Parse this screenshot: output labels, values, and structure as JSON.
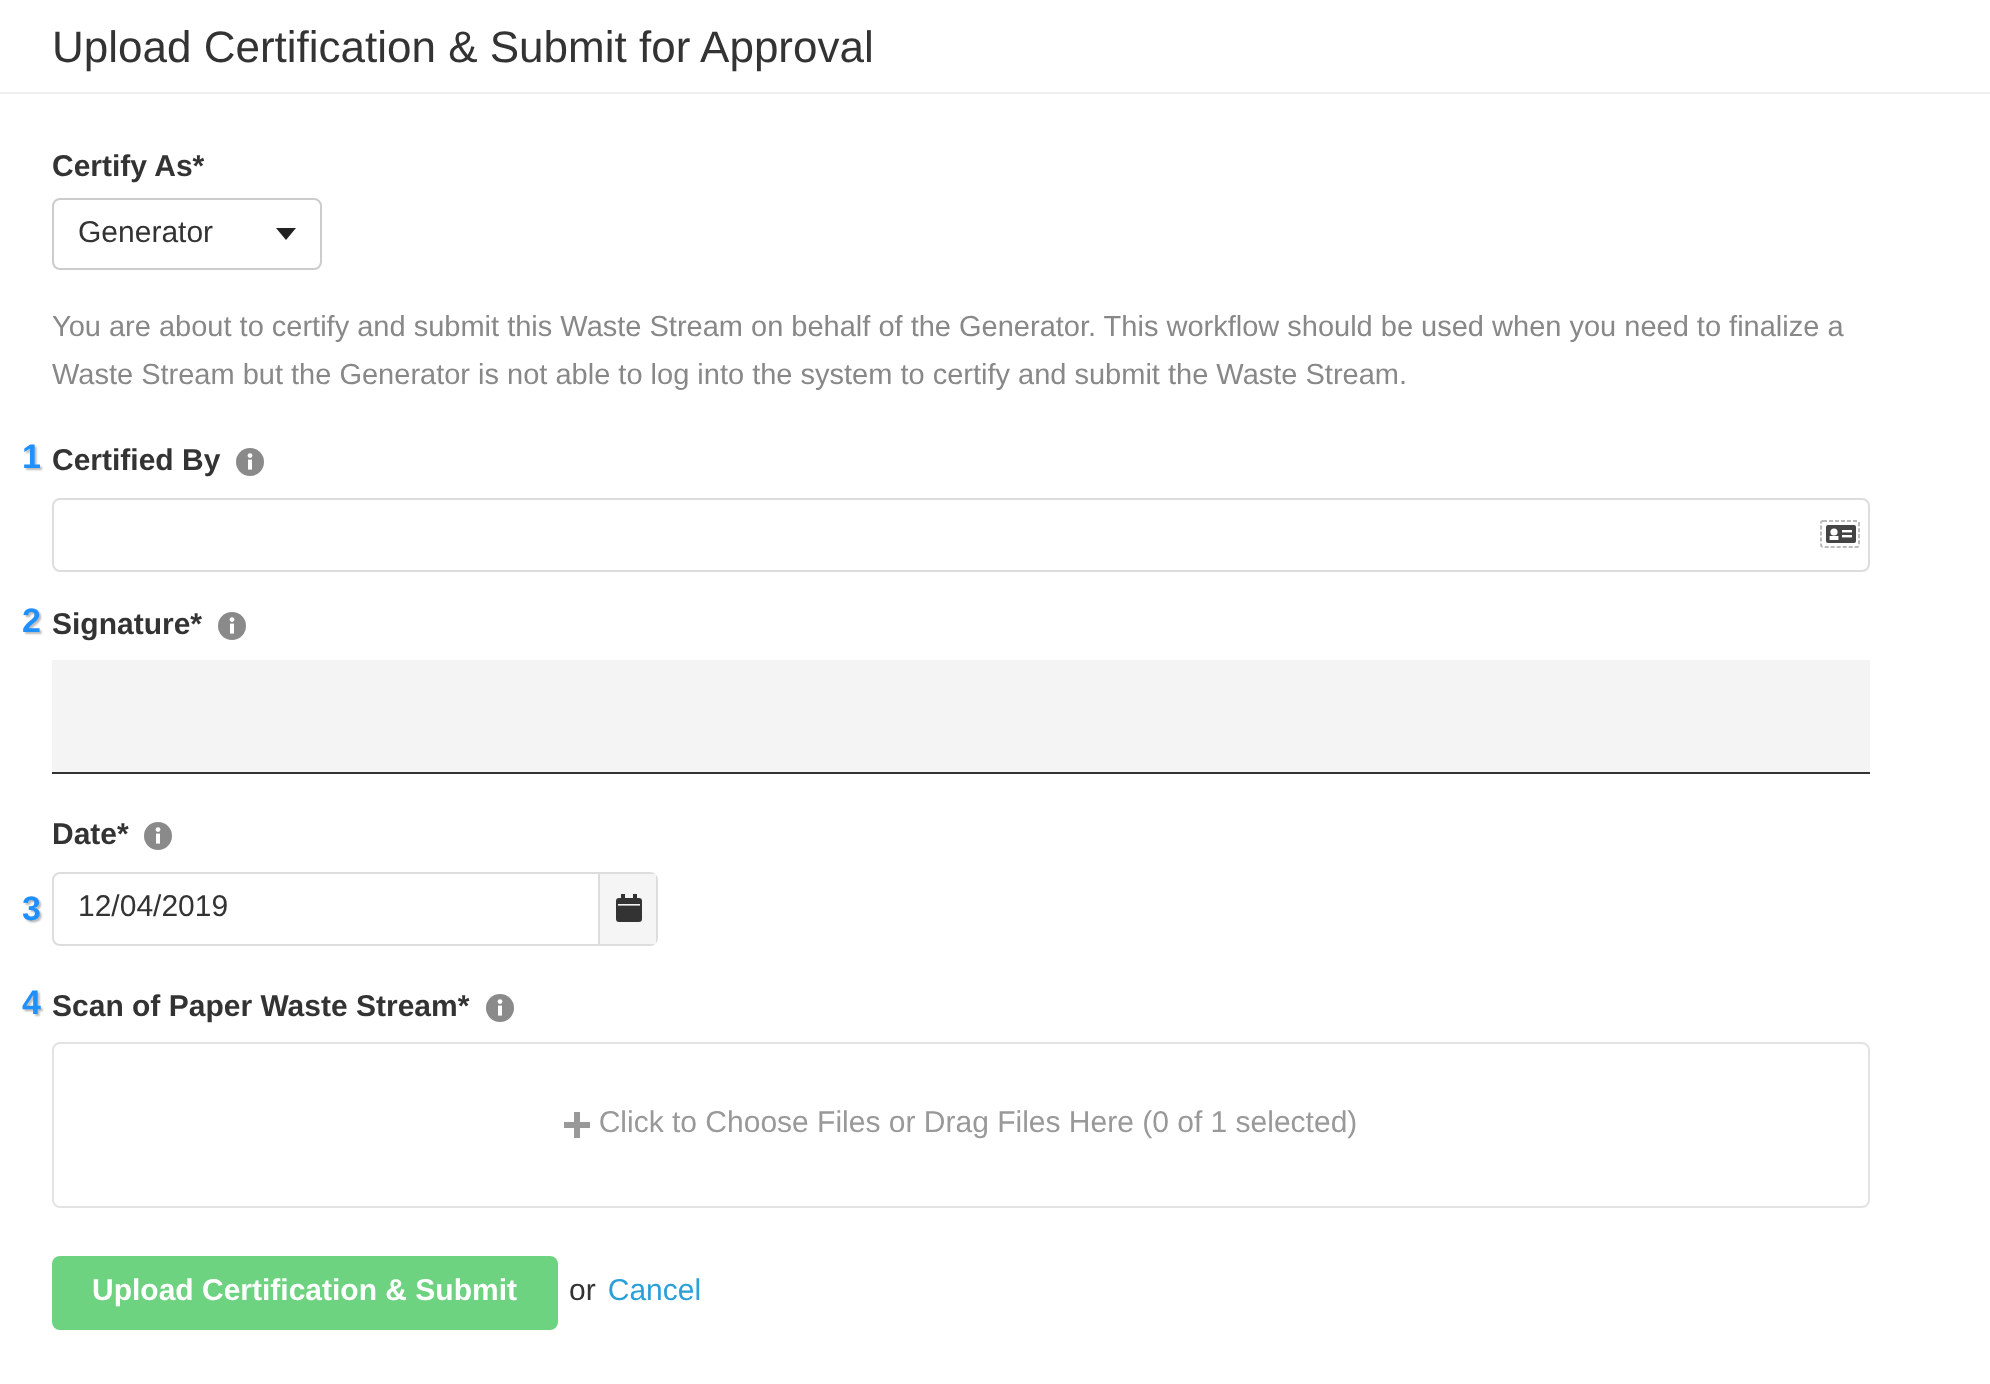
{
  "dialog": {
    "title": "Upload Certification & Submit for Approval"
  },
  "certify_as": {
    "label": "Certify As*",
    "value": "Generator"
  },
  "description": "You are about to certify and submit this Waste Stream on behalf of the Generator. This workflow should be used when you need to finalize a Waste Stream but the Generator is not able to log into the system to certify and submit the Waste Stream.",
  "fields": [
    {
      "kind": "contact",
      "marker": "1",
      "label": "Certified By"
    },
    {
      "kind": "signature",
      "marker": "2",
      "label": "Signature*"
    },
    {
      "kind": "date",
      "marker": "3",
      "label": "Date*",
      "value": "12/04/2019"
    },
    {
      "kind": "file",
      "marker": "4",
      "label": "Scan of Paper Waste Stream*",
      "placeholder": "Click to Choose Files or Drag Files Here (0 of 1 selected)"
    }
  ],
  "submit_button": "Upload Certification & Submit",
  "or_text": "or",
  "cancel_link": "Cancel"
}
